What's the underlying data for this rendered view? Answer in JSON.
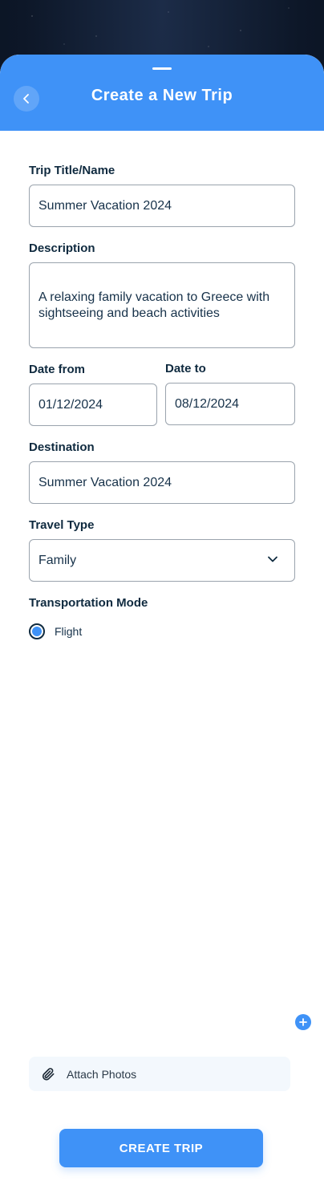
{
  "header": {
    "title": "Create a New Trip",
    "back_icon": "chevron-left-icon"
  },
  "form": {
    "trip_title": {
      "label": "Trip Title/Name",
      "value": "Summer Vacation 2024"
    },
    "description": {
      "label": "Description",
      "value": "A relaxing family vacation to Greece with sightseeing and beach activities"
    },
    "date_from": {
      "label": "Date from",
      "value": "01/12/2024"
    },
    "date_to": {
      "label": "Date to",
      "value": "08/12/2024"
    },
    "destination": {
      "label": "Destination",
      "value": "Summer Vacation 2024"
    },
    "travel_type": {
      "label": "Travel Type",
      "value": "Family"
    },
    "transportation": {
      "label": "Transportation Mode",
      "options": [
        {
          "label": "Flight",
          "selected": true
        }
      ]
    }
  },
  "attach": {
    "label": "Attach Photos",
    "icon": "paperclip-icon",
    "add_icon": "plus-icon"
  },
  "actions": {
    "create_label": "CREATE TRIP"
  },
  "colors": {
    "accent": "#3f92f7",
    "text": "#0f2a3f",
    "border": "#9aa3ad",
    "attach_bg": "#f3f8fd"
  }
}
